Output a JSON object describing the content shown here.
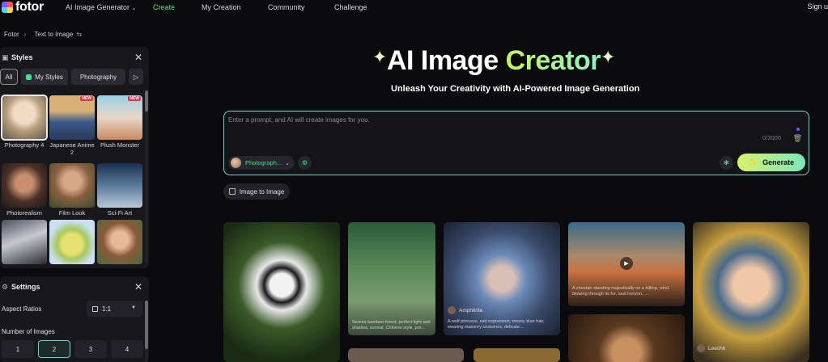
{
  "nav": {
    "brand": "fotor",
    "links": [
      "AI Image Generator",
      "Create",
      "My Creation",
      "Community",
      "Challenge"
    ],
    "active_link": "Create",
    "signup": "Sign u",
    "accent_color": "#3fe08a"
  },
  "breadcrumb": {
    "root": "Fotor",
    "current": "Text to Image"
  },
  "styles_panel": {
    "title": "Styles",
    "filters": [
      "All",
      "My Styles",
      "Photography"
    ],
    "active_filter": "All",
    "items": [
      {
        "label": "Photography 4",
        "badge": "",
        "selected": true
      },
      {
        "label": "Japanese Anime 2",
        "badge": "NEW",
        "selected": false
      },
      {
        "label": "Plush Monster",
        "badge": "NEW",
        "selected": false
      },
      {
        "label": "Photorealism",
        "badge": "",
        "selected": false
      },
      {
        "label": "Film Look",
        "badge": "",
        "selected": false
      },
      {
        "label": "Sci-Fi Art",
        "badge": "",
        "selected": false
      },
      {
        "label": "",
        "badge": "",
        "selected": false
      },
      {
        "label": "",
        "badge": "",
        "selected": false
      },
      {
        "label": "",
        "badge": "",
        "selected": false
      }
    ]
  },
  "settings_panel": {
    "title": "Settings",
    "aspect_label": "Aspect Ratios",
    "aspect_value": "1:1",
    "number_label": "Number of Images",
    "number_options": [
      "1",
      "2",
      "3",
      "4"
    ],
    "number_selected": "2"
  },
  "hero": {
    "title_white": "AI Image",
    "title_gradient": "Creator",
    "subtitle": "Unleash Your Creativity with AI-Powered Image Generation"
  },
  "prompt": {
    "placeholder": "Enter a prompt, and AI will create images for you.",
    "counter": "0/3000",
    "style_pill": "Photograph...",
    "generate_label": "Generate",
    "image_to_image": "Image to Image"
  },
  "gallery": [
    {
      "caption": "",
      "user": ""
    },
    {
      "caption": "Serene bamboo forest, perfect light and shadow, surreal, Chinese style, por...",
      "user": ""
    },
    {
      "caption": "A wolf princess, sad expression, messy blue hair, wearing masonry costumes, delicate...",
      "user": "Amphitrite"
    },
    {
      "caption": "A cheetah standing majestically on a hilltop, wind blowing through its fur, vast horizon, ...",
      "user": ""
    },
    {
      "caption": "",
      "user": "Leechh"
    }
  ]
}
